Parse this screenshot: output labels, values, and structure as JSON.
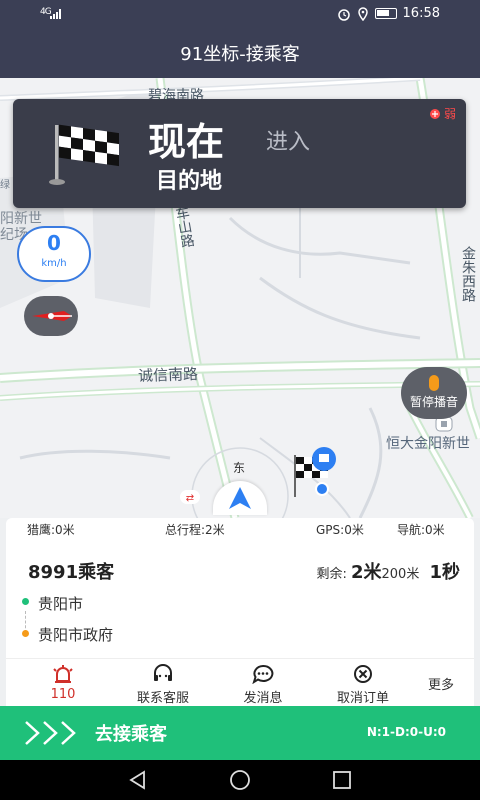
{
  "status_bar": {
    "network": "4G",
    "time": "16:58"
  },
  "header": {
    "title": "91坐标-接乘客"
  },
  "map": {
    "road_labels": {
      "top": "碧海南路",
      "vertical_mid": "车山路",
      "right": "金朱西路",
      "main": "诚信南路",
      "left_poi": "阳新世纪场",
      "left_poi2": "绿",
      "poi_right": "恒大金阳新世",
      "east": "东"
    },
    "speed": {
      "value": "0",
      "unit": "km/h"
    },
    "pause_voice_label": "暂停播音",
    "nav_card": {
      "time_word": "现在",
      "action": "进入",
      "destination": "目的地",
      "signal": "弱"
    },
    "colors": {
      "accent_blue": "#2d7ff2",
      "route_green": "#1fc07a"
    }
  },
  "trip": {
    "stats": {
      "hunt": "猎鹰:0米",
      "total": "总行程:2米",
      "gps": "GPS:0米",
      "nav": "导航:0米"
    },
    "passenger": "8991乘客",
    "remain_prefix": "剩余:",
    "remain_distance": "2米",
    "remain_small": "200米",
    "remain_time": "1秒",
    "origin": "贵阳市",
    "destination": "贵阳市政府"
  },
  "actions": [
    {
      "label": "110",
      "icon": "siren-icon"
    },
    {
      "label": "联系客服",
      "icon": "headset-icon"
    },
    {
      "label": "发消息",
      "icon": "chat-bubble-icon"
    },
    {
      "label": "取消订单",
      "icon": "cancel-circle-icon"
    },
    {
      "label": "更多",
      "icon": ""
    }
  ],
  "bottom_bar": {
    "go_label": "去接乘客",
    "code": "N:1-D:0-U:0"
  }
}
